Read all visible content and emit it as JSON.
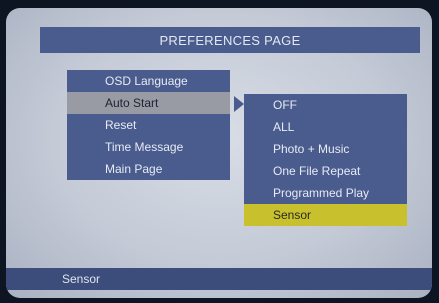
{
  "header": {
    "title": "PREFERENCES PAGE"
  },
  "left_menu": {
    "items": [
      {
        "label": "OSD Language",
        "selected": false
      },
      {
        "label": "Auto Start",
        "selected": true
      },
      {
        "label": "Reset",
        "selected": false
      },
      {
        "label": "Time Message",
        "selected": false
      },
      {
        "label": "Main Page",
        "selected": false
      }
    ]
  },
  "submenu": {
    "items": [
      {
        "label": "OFF",
        "selected": false
      },
      {
        "label": "ALL",
        "selected": false
      },
      {
        "label": "Photo + Music",
        "selected": false
      },
      {
        "label": "One File Repeat",
        "selected": false
      },
      {
        "label": "Programmed Play",
        "selected": false
      },
      {
        "label": "Sensor",
        "selected": true
      }
    ]
  },
  "status_bar": {
    "text": "Sensor"
  },
  "colors": {
    "panel": "#4a5b8e",
    "left_highlight": "#989aa4",
    "submenu_highlight": "#c8c02c",
    "status_bar": "#3c4d7c"
  }
}
